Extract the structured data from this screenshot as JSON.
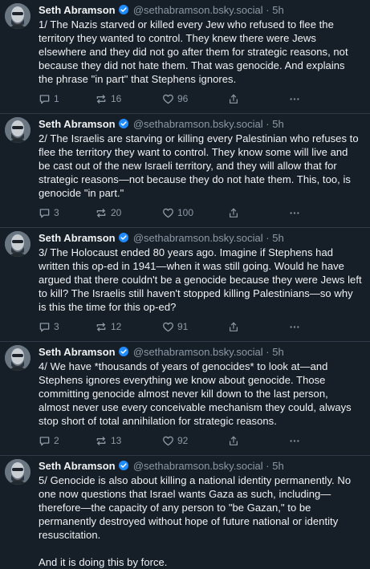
{
  "posts": [
    {
      "author": "Seth Abramson",
      "handle": "@sethabramson.bsky.social",
      "time": "5h",
      "text": "1/ The Nazis starved or killed every Jew who refused to flee the territory they wanted to control. They knew there were Jews elsewhere and they did not go after them for strategic reasons, not because they did not hate them. That was genocide. And explains the phrase \"in part\" that Stephens ignores.",
      "replies": "1",
      "reposts": "16",
      "likes": "96"
    },
    {
      "author": "Seth Abramson",
      "handle": "@sethabramson.bsky.social",
      "time": "5h",
      "text": "2/ The Israelis are starving or killing every Palestinian who refuses to flee the territory they want to control. They know some will live and be cast out of the new Israeli territory, and they will allow that for strategic reasons—not because they do not hate them. This, too, is genocide \"in part.\"",
      "replies": "3",
      "reposts": "20",
      "likes": "100"
    },
    {
      "author": "Seth Abramson",
      "handle": "@sethabramson.bsky.social",
      "time": "5h",
      "text": "3/ The Holocaust ended 80 years ago. Imagine if Stephens had written this op-ed in 1941—when it was still going. Would he have argued that there couldn't be a genocide because they were Jews left to kill? The Israelis still haven't stopped killing Palestinians—so why is this the time for this op-ed?",
      "replies": "3",
      "reposts": "12",
      "likes": "91"
    },
    {
      "author": "Seth Abramson",
      "handle": "@sethabramson.bsky.social",
      "time": "5h",
      "text": "4/ We have *thousands of years of genocides* to look at—and Stephens ignores everything we know about genocide. Those committing genocide almost never kill down to the last person, almost never use every conceivable mechanism they could, always stop short of total annihilation for strategic reasons.",
      "replies": "2",
      "reposts": "13",
      "likes": "92"
    },
    {
      "author": "Seth Abramson",
      "handle": "@sethabramson.bsky.social",
      "time": "5h",
      "text": "5/ Genocide is also about killing a national identity permanently. No one now questions that Israel wants Gaza as such, including—therefore—the capacity of any person to \"be Gazan,\" to be permanently destroyed without hope of future national or identity resuscitation.\n\nAnd it is doing this by force.",
      "replies": "",
      "reposts": "",
      "likes": ""
    }
  ],
  "separator": "·",
  "icons": {
    "verified": "verified-badge-icon",
    "reply": "reply-icon",
    "repost": "repost-icon",
    "like": "heart-icon",
    "share": "share-icon",
    "more": "more-icon"
  },
  "colors": {
    "background": "#161e27",
    "text": "#f1f3f5",
    "muted": "#8d99a6",
    "verified": "#208bfe",
    "divider": "#2e3a47"
  }
}
